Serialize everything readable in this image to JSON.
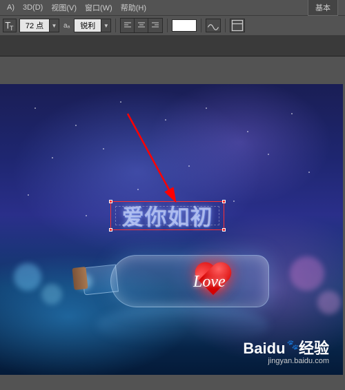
{
  "menu": {
    "items": [
      {
        "label": "A)"
      },
      {
        "label": "3D(D)"
      },
      {
        "label": "视图(V)"
      },
      {
        "label": "窗口(W)"
      },
      {
        "label": "帮助(H)"
      }
    ]
  },
  "workspace": {
    "label": "基本"
  },
  "options": {
    "font_size": "72 点",
    "aa_label": "aₐ",
    "aa_value": "锐利",
    "text_color": "#ffffff"
  },
  "canvas": {
    "editable_text": "爱你如初",
    "heart_text": "Love"
  },
  "watermark": {
    "brand_prefix": "Bai",
    "brand_du": "du",
    "brand_suffix": "经验",
    "url": "jingyan.baidu.com"
  }
}
